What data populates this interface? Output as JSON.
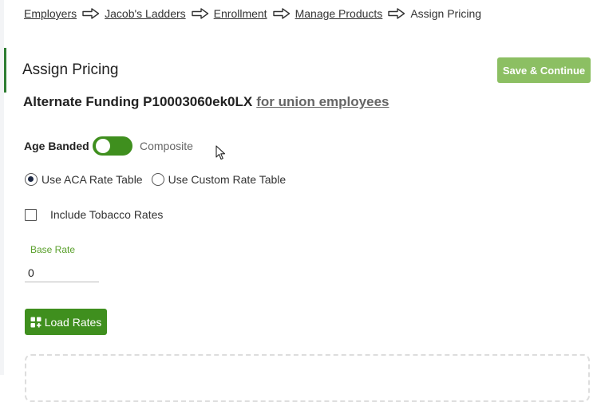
{
  "breadcrumb": {
    "items": [
      "Employers",
      "Jacob's Ladders",
      "Enrollment",
      "Manage Products"
    ],
    "current": "Assign Pricing"
  },
  "page": {
    "title": "Assign Pricing",
    "save_label": "Save & Continue",
    "product_name": "Alternate Funding P10003060ek0LX",
    "product_link": "for union employees"
  },
  "pricing": {
    "age_banded_label": "Age Banded",
    "composite_label": "Composite",
    "rate_table_options": [
      {
        "label": "Use ACA Rate Table",
        "selected": true
      },
      {
        "label": "Use Custom Rate Table",
        "selected": false
      }
    ],
    "tobacco_label": "Include Tobacco Rates",
    "tobacco_checked": false,
    "base_rate_label": "Base Rate",
    "base_rate_value": "0",
    "load_rates_label": "Load Rates"
  },
  "colors": {
    "primary": "#3f8f1e",
    "save_button": "#8cbf63",
    "accent_bar": "#2e7d32",
    "field_label": "#5aa02c"
  }
}
